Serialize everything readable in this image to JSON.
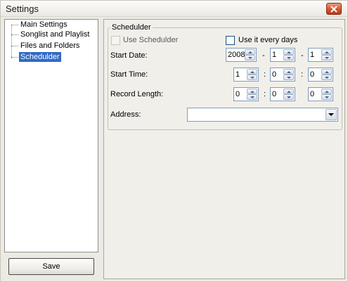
{
  "window": {
    "title": "Settings",
    "close_icon": "close-icon"
  },
  "tree": {
    "items": [
      {
        "label": "Main Settings",
        "selected": false
      },
      {
        "label": "Songlist and Playlist",
        "selected": false
      },
      {
        "label": "Files and Folders",
        "selected": false
      },
      {
        "label": "Schedulder",
        "selected": true
      }
    ]
  },
  "save_button": {
    "label": "Save"
  },
  "scheduler": {
    "group_title": "Schedulder",
    "use_scheduler": {
      "label": "Use Schedulder",
      "checked": false,
      "enabled": false
    },
    "use_every_day": {
      "label": "Use it every days",
      "checked": false
    },
    "start_date": {
      "label": "Start Date:",
      "year": "2008",
      "month": "1",
      "day": "1",
      "separator": "-"
    },
    "start_time": {
      "label": "Start Time:",
      "hour": "1",
      "minute": "0",
      "second": "0",
      "separator": ":"
    },
    "record_length": {
      "label": "Record Length:",
      "hour": "0",
      "minute": "0",
      "second": "0",
      "separator": ":"
    },
    "address": {
      "label": "Address:",
      "value": ""
    }
  },
  "colors": {
    "selection": "#316ac5",
    "window_bg": "#eceae3",
    "panel_bg": "#f1efea",
    "close_button": "#d2552f"
  }
}
